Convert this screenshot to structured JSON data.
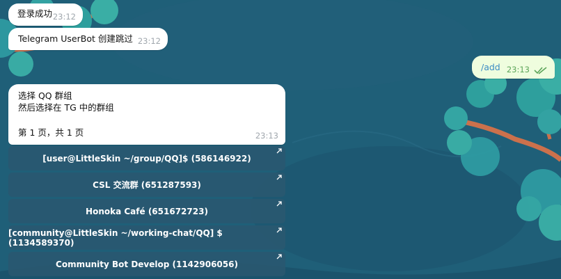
{
  "messages": {
    "login": {
      "text": "登录成功",
      "time": "23:12"
    },
    "userbot": {
      "text": "Telegram UserBot 创建跳过",
      "time": "23:12"
    },
    "add_cmd": {
      "text": "/add",
      "time": "23:13",
      "status": "read"
    },
    "select": {
      "line1": "选择 QQ 群组",
      "line2": "然后选择在 TG 中的群组",
      "line3": "第 1 页，共 1 页",
      "time": "23:13"
    }
  },
  "keyboard": [
    {
      "label": "[user@LittleSkin ~/group/QQ]$ (586146922)"
    },
    {
      "label": "CSL 交流群 (651287593)"
    },
    {
      "label": "Honoka Café (651672723)"
    },
    {
      "label": "[community@LittleSkin ~/working-chat/QQ] $ (1134589370)"
    },
    {
      "label": "Community Bot Develop (1142906056)"
    }
  ],
  "colors": {
    "background": "#1f5f78",
    "incoming_bubble": "#ffffff",
    "outgoing_bubble": "#effdde",
    "accent_link": "#3b8bc4",
    "read_check": "#5da55a"
  }
}
